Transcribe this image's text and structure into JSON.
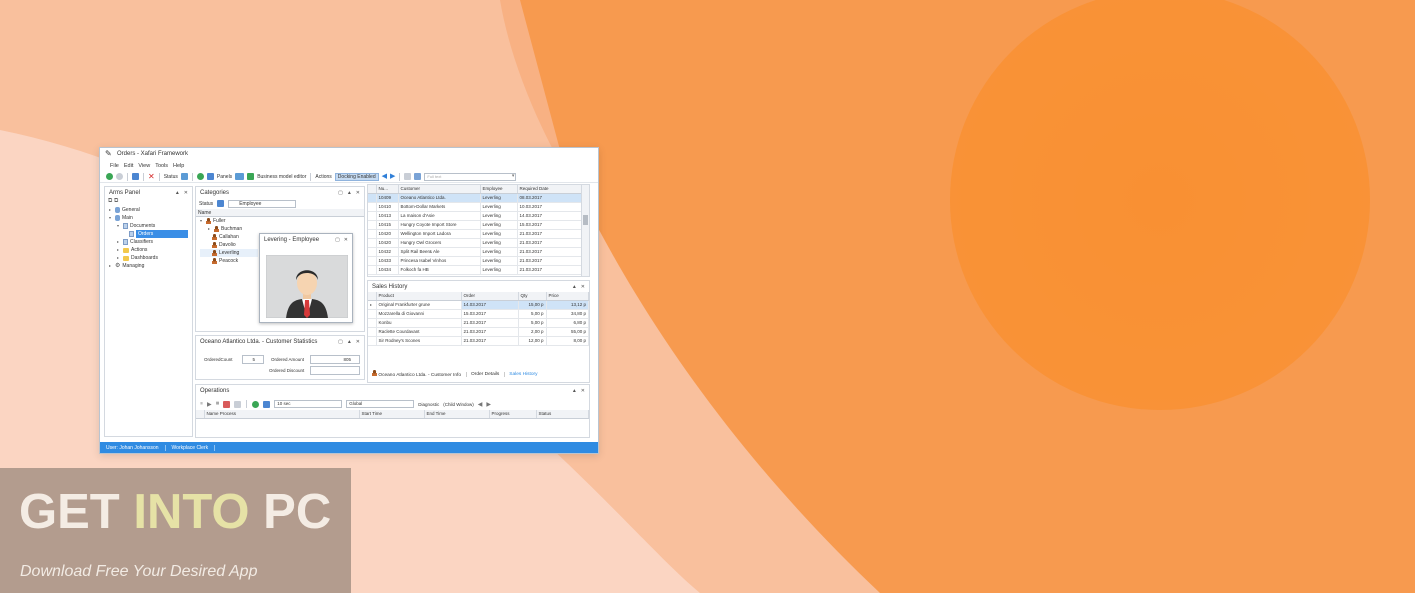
{
  "window": {
    "title": "Orders - Xafari Framework"
  },
  "menu": [
    "File",
    "Edit",
    "View",
    "Tools",
    "Help"
  ],
  "toolbar": {
    "status": "Status",
    "panels": "Panels",
    "business_model_editor": "Business model editor",
    "actions": "Actions",
    "docking_enabled": "Docking Enabled",
    "search_placeholder": "Full text"
  },
  "arms_panel": {
    "title": "Arms Panel",
    "tree": {
      "general": "General",
      "main": "Main",
      "documents": "Documents",
      "orders": "Orders",
      "classifiers": "Classifiers",
      "actions": "Actions",
      "dashboards": "Dashboards",
      "managing": "Managing"
    }
  },
  "categories": {
    "title": "Categories",
    "status": "Status",
    "filter_value": "Employee",
    "column": "Name",
    "people": [
      "Fuller",
      "Buchman",
      "Callahan",
      "Davolio",
      "Leverling",
      "Peacock"
    ]
  },
  "employee_popup": {
    "title": "Levering - Employee"
  },
  "orders_grid": {
    "columns": [
      "Nu...",
      "Customer",
      "Employee",
      "Required Date"
    ],
    "rows": [
      [
        "10409",
        "Oceano Atlantico Ltda.",
        "Leverling",
        "08.03.2017"
      ],
      [
        "10410",
        "Bottom-Dollar Markets",
        "Leverling",
        "10.03.2017"
      ],
      [
        "10413",
        "La maison d'Asie",
        "Leverling",
        "14.03.2017"
      ],
      [
        "10415",
        "Hungry Coyote Import Store",
        "Leverling",
        "15.03.2017"
      ],
      [
        "10420",
        "Wellington Import Ladora",
        "Leverling",
        "21.03.2017"
      ],
      [
        "10420",
        "Hungry Owl Grocers",
        "Leverling",
        "21.03.2017"
      ],
      [
        "10432",
        "Split Rail Beer& Ale",
        "Leverling",
        "21.03.2017"
      ],
      [
        "10433",
        "Princesa Isabel Vinhos",
        "Leverling",
        "21.03.2017"
      ],
      [
        "10434",
        "Folkoch fa HB",
        "Leverling",
        "21.03.2017"
      ]
    ]
  },
  "sales_history": {
    "title": "Sales History",
    "columns": [
      "Product",
      "Order",
      "Qty",
      "Price"
    ],
    "rows": [
      [
        "Original Frankfurter grune",
        "14.03.2017",
        "15,00 p",
        "13,12 p"
      ],
      [
        "Mozzarella di Giovanni",
        "15.03.2017",
        "5,00 p",
        "34,80 p"
      ],
      [
        "Konbu",
        "21.03.2017",
        "5,00 p",
        "6,80 p"
      ],
      [
        "Raclette Courdavant",
        "21.03.2017",
        "2,00 p",
        "55,00 p"
      ],
      [
        "Sir Rodney's Scones",
        "21.03.2017",
        "12,00 p",
        "8,00 p"
      ]
    ],
    "tabs": [
      "Oceano Atlantico Ltda. - Customer Info",
      "Order Details",
      "Sales History"
    ]
  },
  "customer_stats": {
    "title": "Oceano Atlantico Ltda. - Customer Statistics",
    "ordered_count_label": "OrderedCount",
    "ordered_count_value": "5",
    "ordered_amount_label": "Ordered Amount",
    "ordered_amount_value": "805",
    "ordered_discount_label": "Ordered Discount"
  },
  "operations": {
    "title": "Operations",
    "interval": "10 sec",
    "scope": "Global",
    "diagnostic_label": "Diagnostic",
    "diagnostic_value": "(Child Window)",
    "columns": [
      "Name Process",
      "Start Time",
      "End Time",
      "Progress",
      "Status"
    ]
  },
  "statusbar": {
    "user": "User: Johan Johansson",
    "workplace": "Workplace Clerk"
  },
  "watermark": {
    "word1": "GET",
    "word2": "INTO",
    "word3": "PC",
    "subtitle": "Download Free Your Desired App"
  }
}
